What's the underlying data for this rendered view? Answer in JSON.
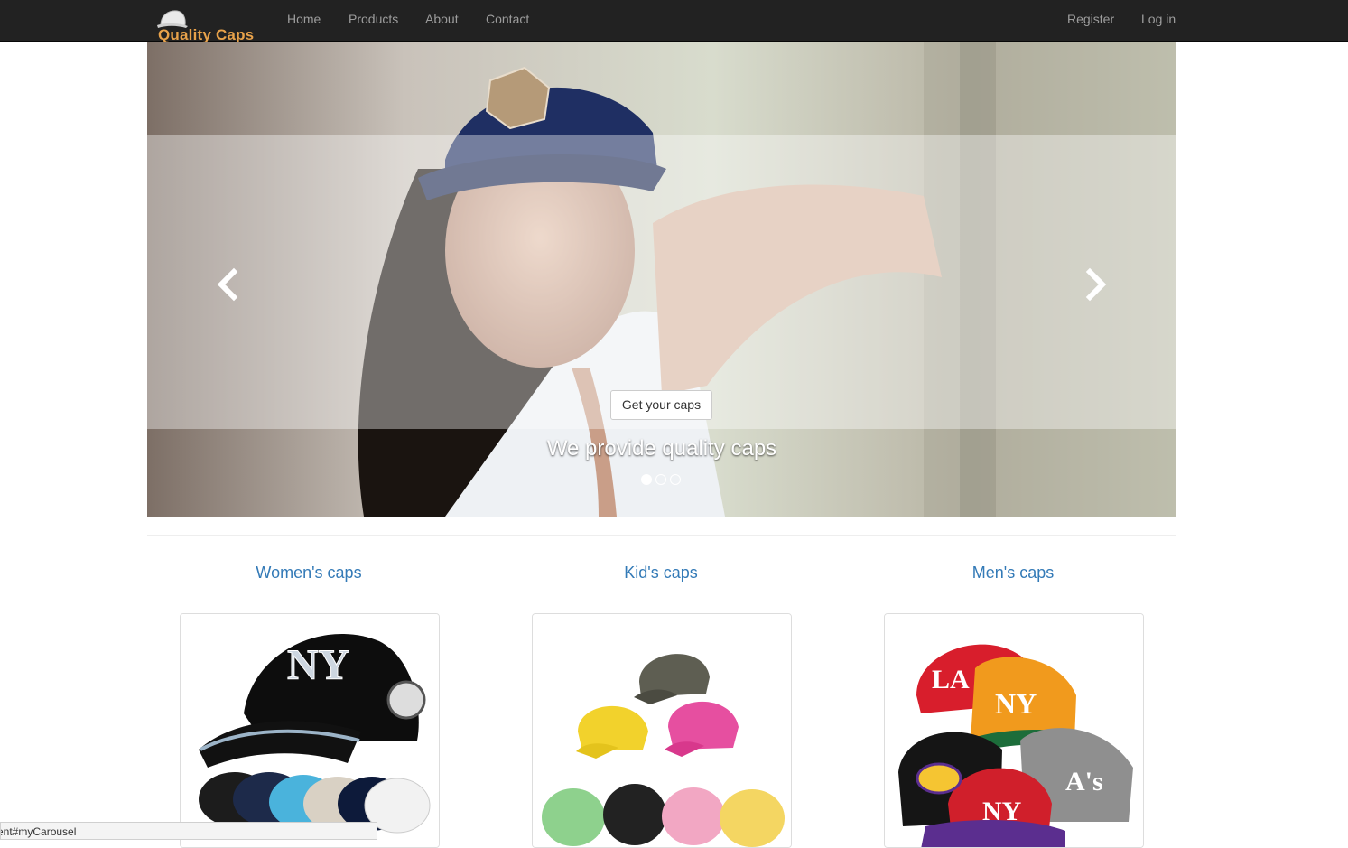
{
  "navbar": {
    "brand": "Quality Caps",
    "links": [
      "Home",
      "Products",
      "About",
      "Contact"
    ],
    "right_links": [
      "Register",
      "Log in"
    ]
  },
  "carousel": {
    "button_label": "Get your caps",
    "caption": "We provide quality caps",
    "slide_count": 3,
    "active_slide": 1,
    "prev_icon": "chevron-left-icon",
    "next_icon": "chevron-right-icon"
  },
  "categories": [
    {
      "title": "Women's caps"
    },
    {
      "title": "Kid's caps"
    },
    {
      "title": "Men's caps"
    }
  ],
  "statusbar": {
    "text": "ent#myCarousel"
  },
  "colors": {
    "navbar_bg": "#222222",
    "nav_text": "#9d9d9d",
    "link_blue": "#337ab7",
    "brand_orange": "#e8a24a"
  }
}
